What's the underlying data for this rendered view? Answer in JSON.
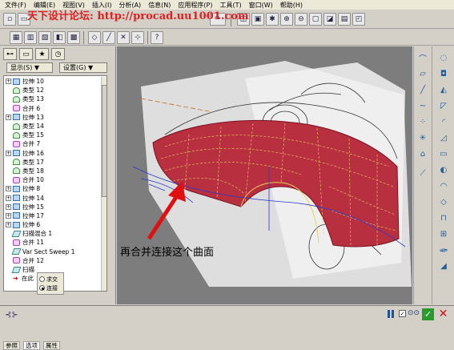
{
  "menubar": {
    "items": [
      "文件(F)",
      "编辑(E)",
      "视图(V)",
      "插入(I)",
      "分析(A)",
      "信息(N)",
      "应用程序(P)",
      "工具(T)",
      "窗口(W)",
      "帮助(H)"
    ]
  },
  "watermark": {
    "text": "天下设计论坛: http://procad.uu1001.com"
  },
  "left_panel": {
    "show_dropdown": "显示(S) ▼",
    "settings_dropdown": "设置(G) ▼",
    "tree": [
      {
        "expand": "+",
        "icon": "extrude-icon",
        "label": "拉伸 10"
      },
      {
        "expand": "",
        "icon": "boundary-icon",
        "label": "类型 12"
      },
      {
        "expand": "",
        "icon": "boundary-icon",
        "label": "类型 13"
      },
      {
        "expand": "",
        "icon": "merge-icon",
        "label": "合并 6"
      },
      {
        "expand": "+",
        "icon": "extrude-icon",
        "label": "拉伸 13"
      },
      {
        "expand": "",
        "icon": "boundary-icon",
        "label": "类型 14"
      },
      {
        "expand": "",
        "icon": "boundary-icon",
        "label": "类型 15"
      },
      {
        "expand": "",
        "icon": "merge-icon",
        "label": "合并 7"
      },
      {
        "expand": "+",
        "icon": "extrude-icon",
        "label": "拉伸 16"
      },
      {
        "expand": "",
        "icon": "boundary-icon",
        "label": "类型 17"
      },
      {
        "expand": "",
        "icon": "boundary-icon",
        "label": "类型 18"
      },
      {
        "expand": "",
        "icon": "merge-icon",
        "label": "合并 10"
      },
      {
        "expand": "+",
        "icon": "extrude-icon",
        "label": "拉伸 8"
      },
      {
        "expand": "+",
        "icon": "extrude-icon",
        "label": "拉伸 14"
      },
      {
        "expand": "+",
        "icon": "extrude-icon",
        "label": "拉伸 15"
      },
      {
        "expand": "+",
        "icon": "extrude-icon",
        "label": "拉伸 17"
      },
      {
        "expand": "+",
        "icon": "extrude-icon",
        "label": "拉伸 6"
      },
      {
        "expand": "",
        "icon": "sweep-icon",
        "label": "扫描混合 1"
      },
      {
        "expand": "",
        "icon": "merge-icon",
        "label": "合并 11"
      },
      {
        "expand": "",
        "icon": "sweep-icon",
        "label": "Var Sect Sweep 1"
      },
      {
        "expand": "",
        "icon": "merge-icon",
        "label": "合并 12"
      },
      {
        "expand": "",
        "icon": "sweep-icon",
        "label": "扫描"
      },
      {
        "expand": "",
        "icon": "insert-here-icon",
        "label": "在此"
      }
    ],
    "radio": {
      "option1": "求交",
      "option2": "连接",
      "selected": "连接"
    },
    "bottom_tabs": [
      "参照",
      "选项",
      "属性"
    ]
  },
  "annotation": {
    "text": "再合并连接这个曲面"
  },
  "colors": {
    "surface": "#b83040",
    "surface_edge": "#e8d060",
    "viewport_bg": "#7d7d7d",
    "annotation_arrow": "#e01010"
  }
}
